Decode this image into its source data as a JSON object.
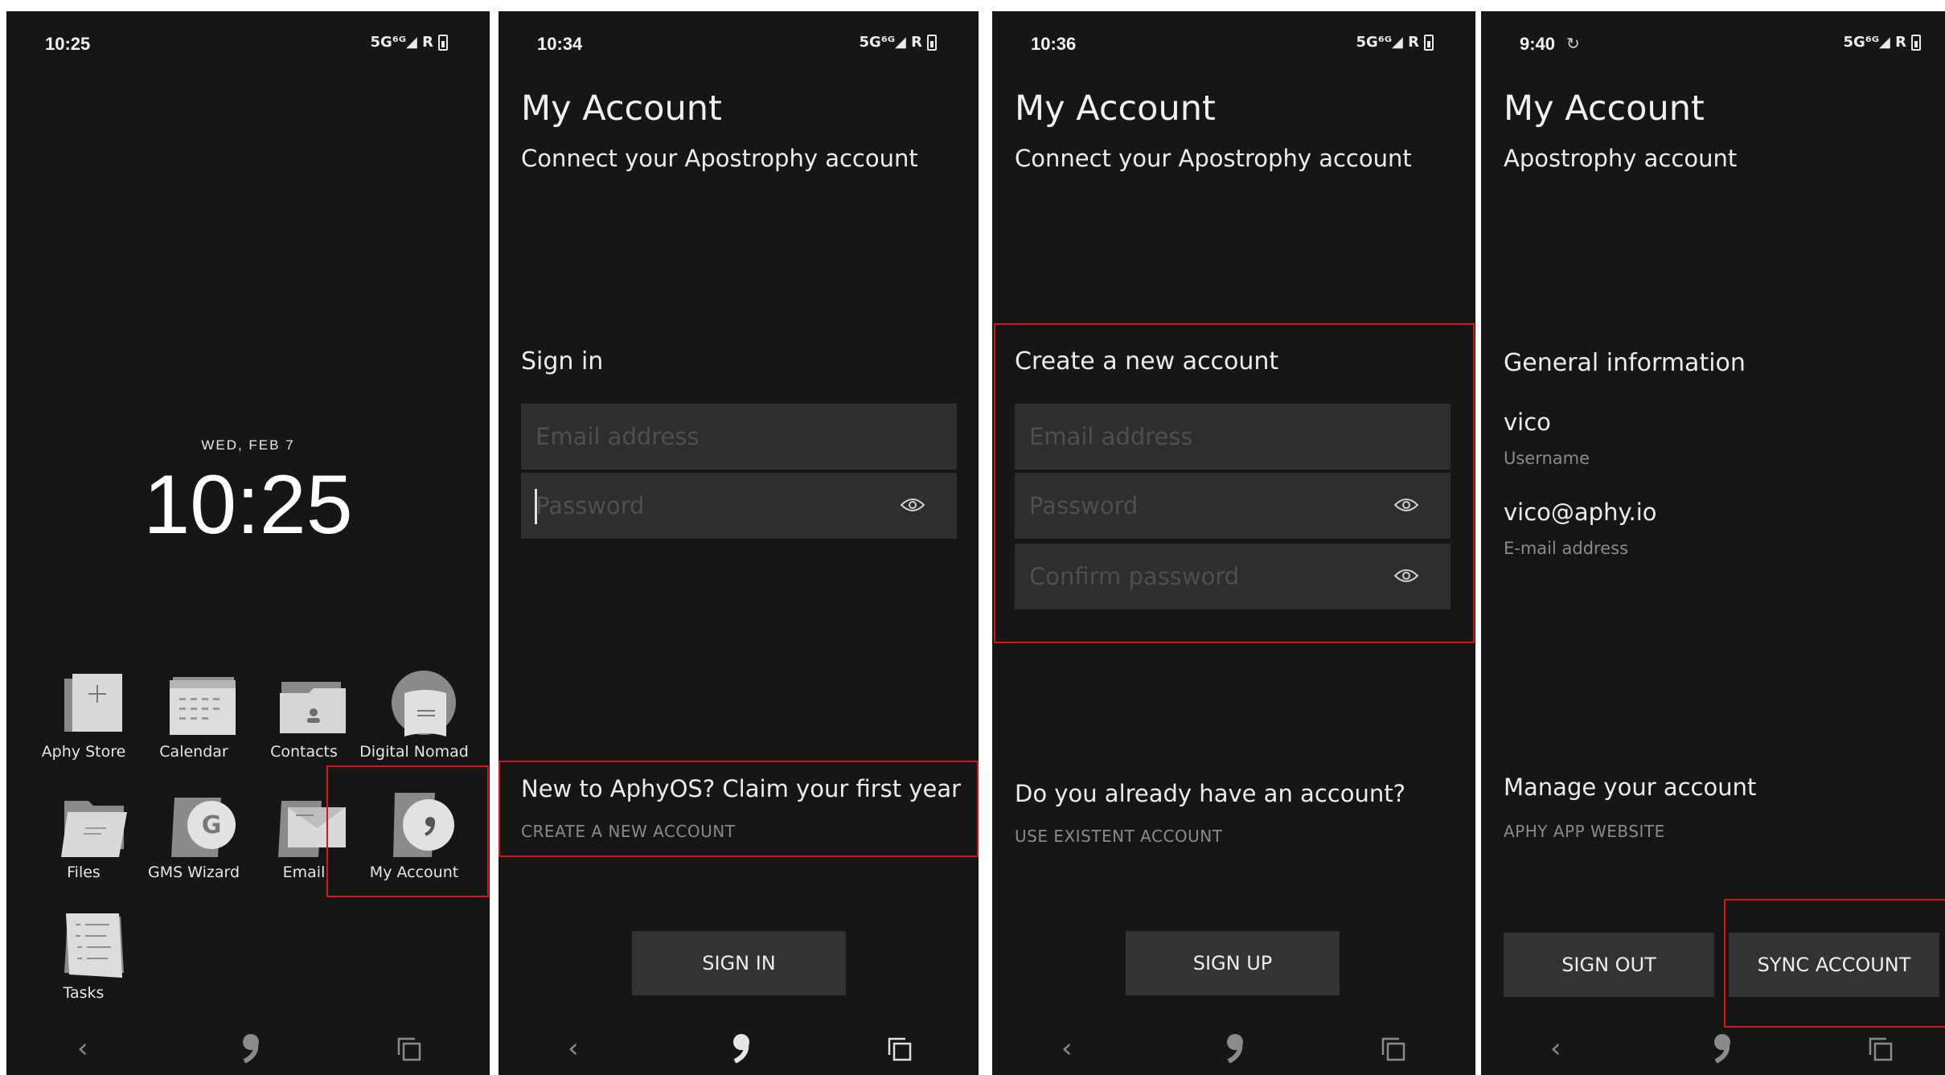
{
  "screens": [
    {
      "status_time": "10:25",
      "status_icons": "5G⁶ᴳ◢ R",
      "date": "WED, FEB 7",
      "clock": "10:25",
      "apps": [
        {
          "label": "Aphy Store",
          "icon": "store-icon"
        },
        {
          "label": "Calendar",
          "icon": "calendar-icon"
        },
        {
          "label": "Contacts",
          "icon": "contacts-icon"
        },
        {
          "label": "Digital Nomad",
          "icon": "digital-nomad-icon"
        },
        {
          "label": "Files",
          "icon": "folder-icon"
        },
        {
          "label": "GMS Wizard",
          "icon": "gms-wizard-icon"
        },
        {
          "label": "Email",
          "icon": "email-icon"
        },
        {
          "label": "My Account",
          "icon": "account-icon"
        },
        {
          "label": "Tasks",
          "icon": "tasks-icon"
        }
      ]
    },
    {
      "status_time": "10:34",
      "status_icons": "5G⁶ᴳ◢ R",
      "title": "My Account",
      "subtitle": "Connect your Apostrophy account",
      "section": "Sign in",
      "email_placeholder": "Email address",
      "password_placeholder": "Password",
      "promo": "New to AphyOS? Claim your first year",
      "promo_link": "CREATE A NEW ACCOUNT",
      "button": "SIGN IN"
    },
    {
      "status_time": "10:36",
      "status_icons": "5G⁶ᴳ◢ R",
      "title": "My Account",
      "subtitle": "Connect your Apostrophy account",
      "section": "Create a new account",
      "email_placeholder": "Email address",
      "password_placeholder": "Password",
      "confirm_placeholder": "Confirm password",
      "question": "Do you already have an account?",
      "question_link": "USE EXISTENT ACCOUNT",
      "button": "SIGN UP"
    },
    {
      "status_time": "9:40",
      "status_sync": "↻",
      "status_icons": "5G⁶ᴳ◢ R",
      "title": "My Account",
      "subtitle": "Apostrophy account",
      "section": "General information",
      "username": "vico",
      "username_label": "Username",
      "email": "vico@aphy.io",
      "email_label": "E-mail address",
      "manage": "Manage your account",
      "manage_link": "APHY APP WEBSITE",
      "sign_out": "SIGN OUT",
      "sync": "SYNC ACCOUNT"
    }
  ],
  "nav": {
    "back": "‹"
  },
  "colors": {
    "background": "#161616",
    "field": "#2e2e2e",
    "button": "#333333",
    "highlight": "#d01818"
  }
}
